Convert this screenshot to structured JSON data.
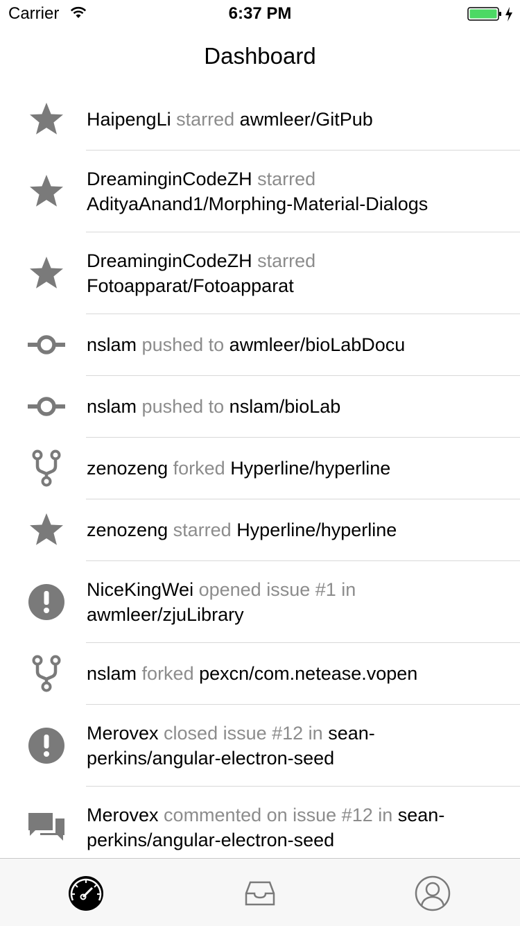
{
  "status_bar": {
    "carrier": "Carrier",
    "time": "6:37 PM",
    "battery_color": "#4cd964"
  },
  "nav": {
    "title": "Dashboard"
  },
  "feed": [
    {
      "icon": "star-icon",
      "actor": "HaipengLi",
      "action": "starred",
      "target": "awmleer/GitPub"
    },
    {
      "icon": "star-icon",
      "actor": "DreaminginCodeZH",
      "action": "starred",
      "target": "AdityaAnand1/Morphing-Material-Dialogs"
    },
    {
      "icon": "star-icon",
      "actor": "DreaminginCodeZH",
      "action": "starred",
      "target": "Fotoapparat/Fotoapparat"
    },
    {
      "icon": "commit-icon",
      "actor": "nslam",
      "action": "pushed to",
      "target": "awmleer/bioLabDocu"
    },
    {
      "icon": "commit-icon",
      "actor": "nslam",
      "action": "pushed to",
      "target": "nslam/bioLab"
    },
    {
      "icon": "fork-icon",
      "actor": "zenozeng",
      "action": "forked",
      "target": "Hyperline/hyperline"
    },
    {
      "icon": "star-icon",
      "actor": "zenozeng",
      "action": "starred",
      "target": "Hyperline/hyperline"
    },
    {
      "icon": "issue-icon",
      "actor": "NiceKingWei",
      "action": "opened issue #1 in",
      "target": "awmleer/zjuLibrary"
    },
    {
      "icon": "fork-icon",
      "actor": "nslam",
      "action": "forked",
      "target": "pexcn/com.netease.vopen"
    },
    {
      "icon": "issue-icon",
      "actor": "Merovex",
      "action": "closed issue #12 in",
      "target": "sean-perkins/angular-electron-seed"
    },
    {
      "icon": "comment-icon",
      "actor": "Merovex",
      "action": "commented on issue #12 in",
      "target": "sean-perkins/angular-electron-seed"
    }
  ],
  "tabs": [
    {
      "icon": "dashboard-gauge-icon",
      "selected": true
    },
    {
      "icon": "inbox-tray-icon",
      "selected": false
    },
    {
      "icon": "profile-person-icon",
      "selected": false
    }
  ],
  "colors": {
    "icon_gray": "#7a7a7a",
    "muted_text": "#8c8c8c",
    "separator": "#d8d8d8",
    "tabbar_bg": "#f7f7f7"
  }
}
